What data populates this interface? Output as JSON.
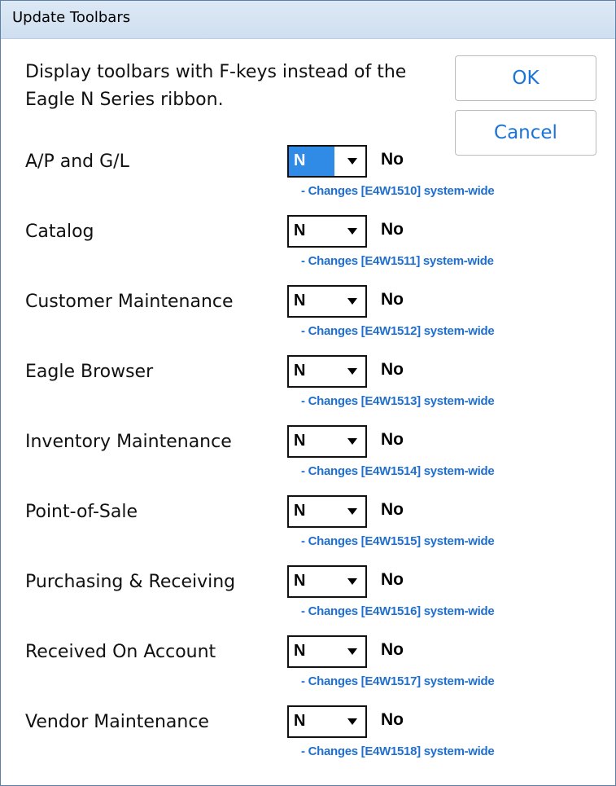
{
  "window": {
    "title": "Update Toolbars"
  },
  "description": "Display toolbars with F-keys instead of the Eagle N Series ribbon.",
  "buttons": {
    "ok": "OK",
    "cancel": "Cancel"
  },
  "rows": [
    {
      "label": "A/P and G/L",
      "value": "N",
      "status": "No",
      "note": "- Changes [E4W1510] system-wide",
      "selected": true
    },
    {
      "label": "Catalog",
      "value": "N",
      "status": "No",
      "note": "- Changes [E4W1511] system-wide",
      "selected": false
    },
    {
      "label": "Customer Maintenance",
      "value": "N",
      "status": "No",
      "note": "- Changes [E4W1512] system-wide",
      "selected": false
    },
    {
      "label": "Eagle Browser",
      "value": "N",
      "status": "No",
      "note": "- Changes [E4W1513] system-wide",
      "selected": false
    },
    {
      "label": "Inventory Maintenance",
      "value": "N",
      "status": "No",
      "note": "- Changes [E4W1514] system-wide",
      "selected": false
    },
    {
      "label": "Point-of-Sale",
      "value": "N",
      "status": "No",
      "note": "- Changes [E4W1515] system-wide",
      "selected": false
    },
    {
      "label": "Purchasing & Receiving",
      "value": "N",
      "status": "No",
      "note": "- Changes [E4W1516] system-wide",
      "selected": false
    },
    {
      "label": "Received On Account",
      "value": "N",
      "status": "No",
      "note": "- Changes [E4W1517] system-wide",
      "selected": false
    },
    {
      "label": "Vendor Maintenance",
      "value": "N",
      "status": "No",
      "note": "- Changes [E4W1518] system-wide",
      "selected": false
    }
  ],
  "icons": {
    "dropdown": "chevron-down-icon"
  }
}
